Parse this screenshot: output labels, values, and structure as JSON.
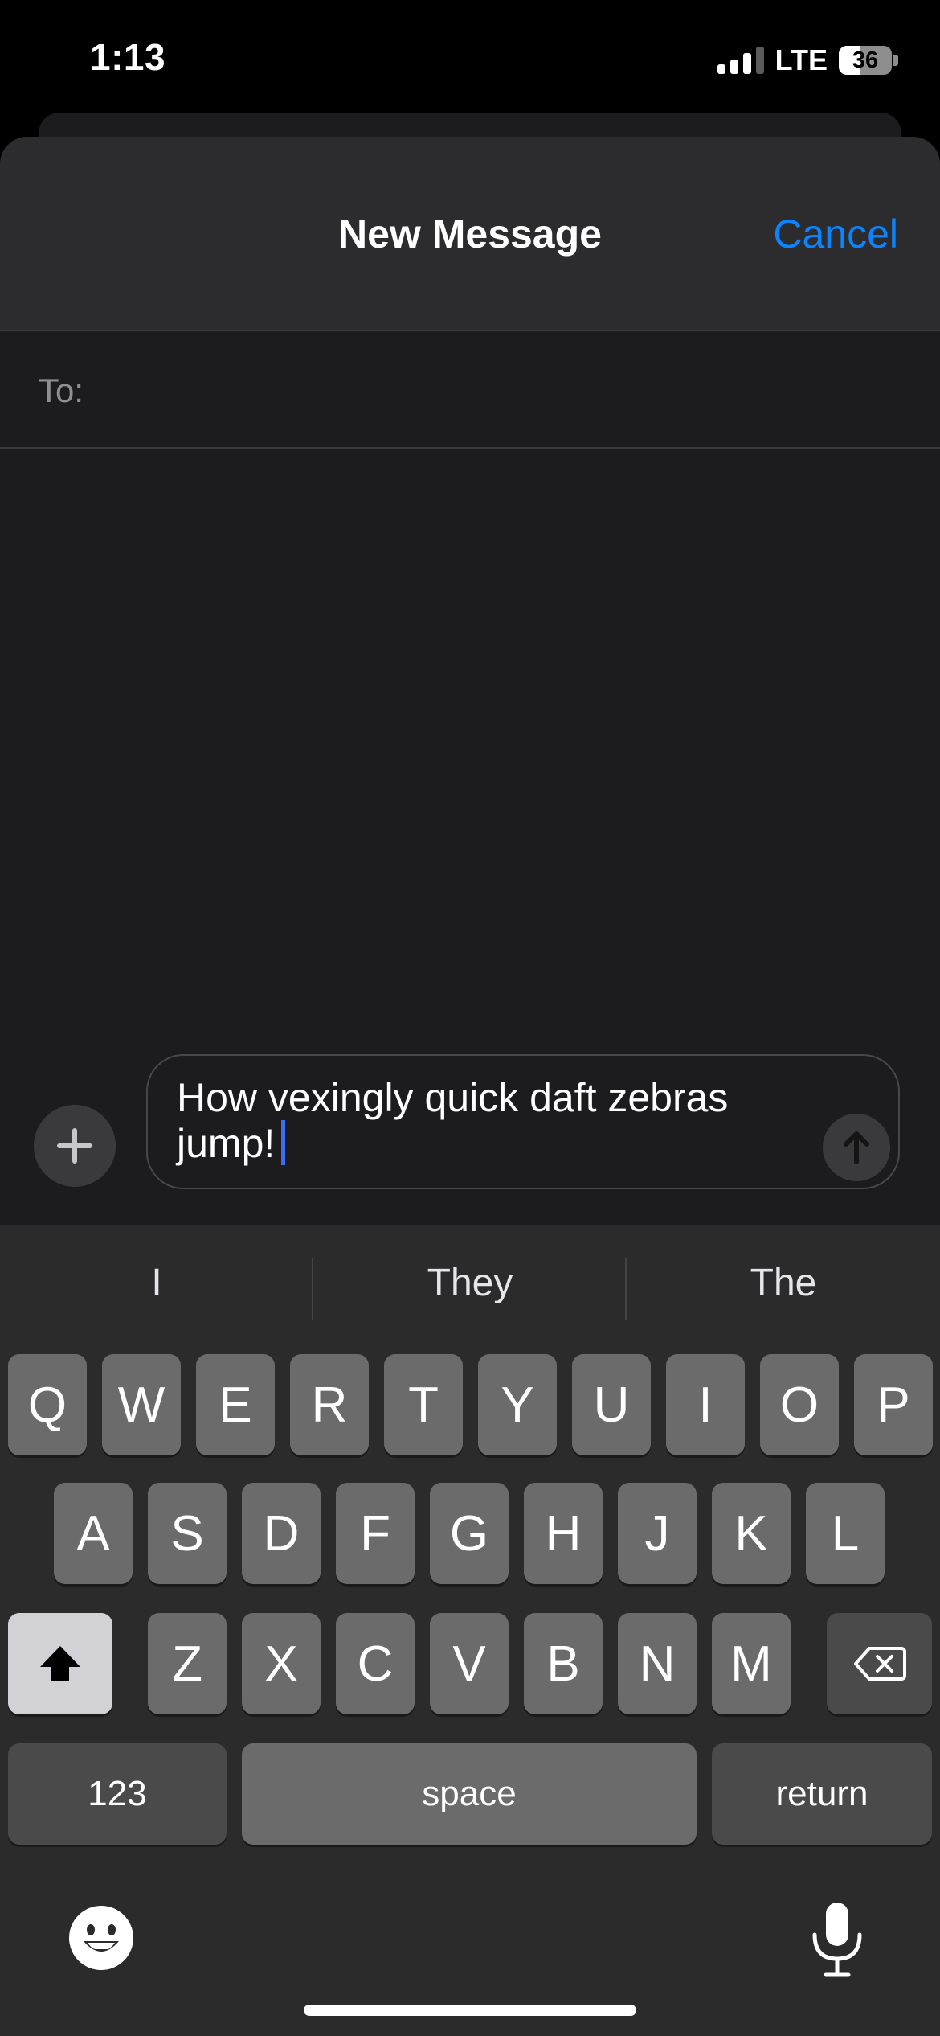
{
  "status_bar": {
    "time": "1:13",
    "network": "LTE",
    "battery": "36"
  },
  "nav": {
    "title": "New Message",
    "cancel_label": "Cancel"
  },
  "to_field": {
    "label": "To:"
  },
  "compose": {
    "text_line1": "How vexingly quick daft zebras",
    "text_line2": "jump!"
  },
  "keyboard": {
    "suggestions": [
      "I",
      "They",
      "The"
    ],
    "row1": [
      "Q",
      "W",
      "E",
      "R",
      "T",
      "Y",
      "U",
      "I",
      "O",
      "P"
    ],
    "row2": [
      "A",
      "S",
      "D",
      "F",
      "G",
      "H",
      "J",
      "K",
      "L"
    ],
    "row3": [
      "Z",
      "X",
      "C",
      "V",
      "B",
      "N",
      "M"
    ],
    "numbers_label": "123",
    "space_label": "space",
    "return_label": "return"
  },
  "colors": {
    "accent": "#0a84ff",
    "caret": "#3d6cf5"
  }
}
